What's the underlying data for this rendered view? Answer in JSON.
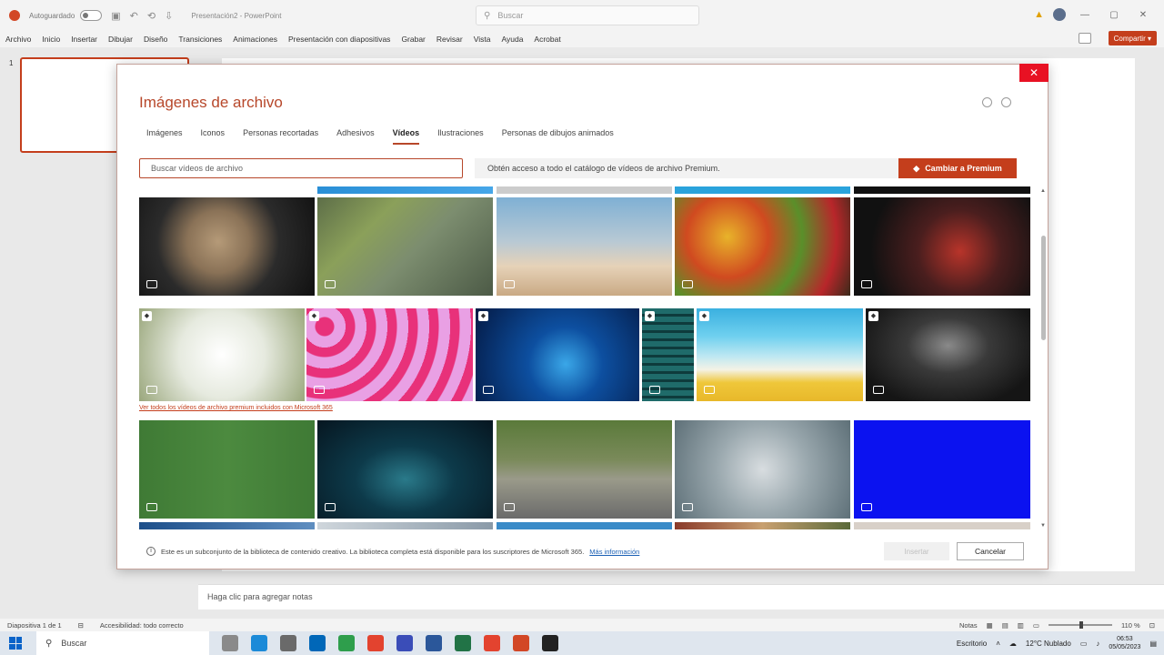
{
  "titlebar": {
    "autosave_label": "Autoguardado",
    "document_title": "Presentación2 - PowerPoint",
    "search_placeholder": "Buscar"
  },
  "ribbon_tabs": [
    "Archivo",
    "Inicio",
    "Insertar",
    "Dibujar",
    "Diseño",
    "Transiciones",
    "Animaciones",
    "Presentación con diapositivas",
    "Grabar",
    "Revisar",
    "Vista",
    "Ayuda",
    "Acrobat"
  ],
  "share_label": "Compartir",
  "slide_number": "1",
  "notes_placeholder": "Haga clic para agregar notas",
  "statusbar": {
    "slide_info": "Diapositiva 1 de 1",
    "accessibility": "Accesibilidad: todo correcto",
    "notes_label": "Notas",
    "zoom": "110 %"
  },
  "taskbar": {
    "search_label": "Buscar",
    "desktop_label": "Escritorio",
    "weather": "12°C  Nublado",
    "time": "06:53",
    "date": "05/05/2023"
  },
  "dialog": {
    "title": "Imágenes de archivo",
    "tabs": [
      {
        "label": "Imágenes",
        "active": false
      },
      {
        "label": "Iconos",
        "active": false
      },
      {
        "label": "Personas recortadas",
        "active": false
      },
      {
        "label": "Adhesivos",
        "active": false
      },
      {
        "label": "Vídeos",
        "active": true
      },
      {
        "label": "Ilustraciones",
        "active": false
      },
      {
        "label": "Personas de dibujos animados",
        "active": false
      }
    ],
    "search_placeholder": "Buscar vídeos de archivo",
    "premium_message": "Obtén acceso a todo el catálogo de vídeos de archivo Premium.",
    "premium_button": "Cambiar a Premium",
    "premium_link": "Ver todos los vídeos de archivo premium incluidos con Microsoft 365",
    "footer_info": "Este es un subconjunto de la biblioteca de contenido creativo. La biblioteca completa está disponible para los suscriptores de Microsoft 365.",
    "footer_link": "Más información",
    "insert_button": "Insertar",
    "cancel_button": "Cancelar",
    "close_icon": "close-icon"
  },
  "videos": {
    "row1": [
      "cat",
      "green-leaves",
      "palm-beach",
      "vegetables",
      "city-lights-bokeh"
    ],
    "row2": [
      "white-blossoms",
      "pink-hearts",
      "blue-particles",
      "glass-building",
      "layered-waves",
      "dark-ocean-waves"
    ],
    "row3": [
      "foosball-table",
      "blue-digital-wave",
      "skateboard",
      "molecule-model",
      "solid-blue"
    ],
    "premium_row": "row2"
  },
  "colors": {
    "accent": "#b7472a",
    "premium_button": "#c43e1c",
    "close": "#e81123"
  }
}
